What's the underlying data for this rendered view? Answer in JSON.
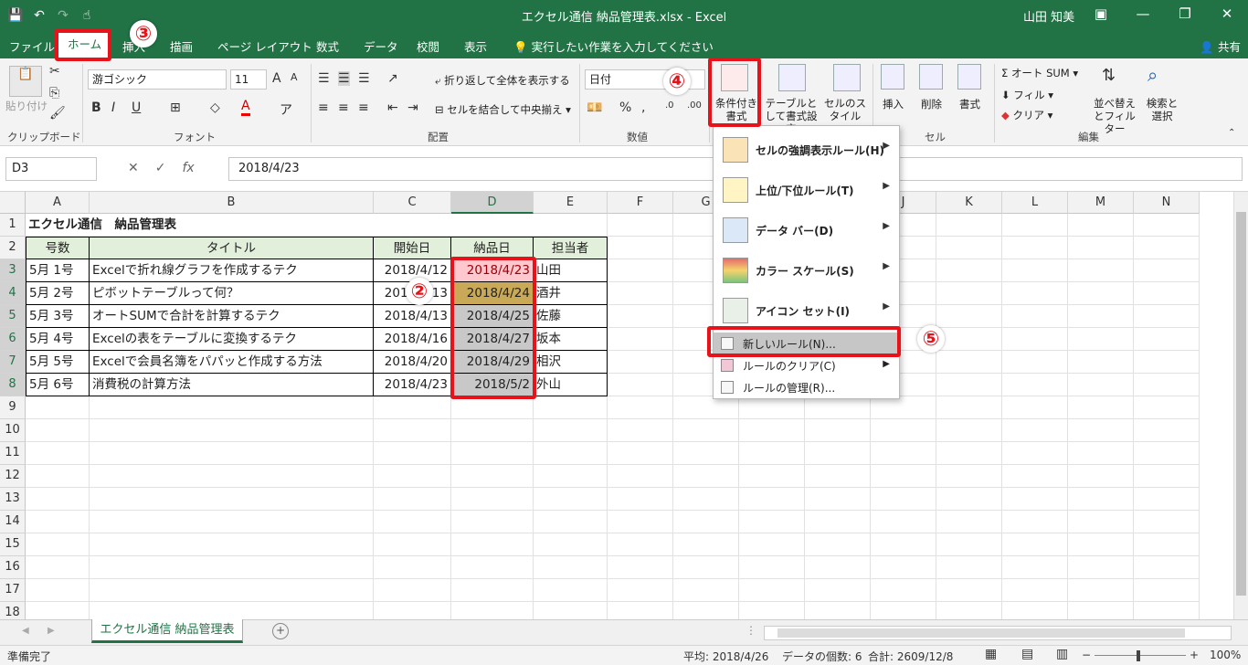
{
  "window": {
    "title": "エクセル通信 納品管理表.xlsx  -  Excel",
    "user": "山田 知美"
  },
  "tabs": [
    "ファイル",
    "ホーム",
    "挿入",
    "描画",
    "ページ レイアウト",
    "数式",
    "データ",
    "校閲",
    "表示"
  ],
  "tell_me": "実行したい作業を入力してください",
  "share": "共有",
  "ribbon": {
    "paste": "貼り付け",
    "font_name": "游ゴシック",
    "font_size": "11",
    "wrap_text": "折り返して全体を表示する",
    "merge_center": "セルを結合して中央揃え",
    "number_format": "日付",
    "conditional_format": "条件付き書式",
    "format_as_table": "テーブルとして書式設定",
    "cell_styles": "セルのスタイル",
    "insert": "挿入",
    "delete": "削除",
    "format": "書式",
    "autosum": "オート SUM",
    "fill": "フィル",
    "clear": "クリア",
    "sort_filter": "並べ替えとフィルター",
    "find_select": "検索と選択",
    "groups": [
      "クリップボード",
      "フォント",
      "配置",
      "数値",
      "セル",
      "編集"
    ]
  },
  "formula_bar": {
    "name_box": "D3",
    "formula": "2018/4/23"
  },
  "columns": [
    "A",
    "B",
    "C",
    "D",
    "E",
    "F",
    "G",
    "H",
    "I",
    "J",
    "K",
    "L",
    "M",
    "N"
  ],
  "rows": [
    "1",
    "2",
    "3",
    "4",
    "5",
    "6",
    "7",
    "8",
    "9",
    "10",
    "11",
    "12",
    "13",
    "14",
    "15",
    "16",
    "17",
    "18"
  ],
  "sheet": {
    "title": "エクセル通信　納品管理表",
    "headers": [
      "号数",
      "タイトル",
      "開始日",
      "納品日",
      "担当者"
    ],
    "data": [
      [
        "5月 1号",
        "Excelで折れ線グラフを作成するテク",
        "2018/4/12",
        "2018/4/23",
        "山田"
      ],
      [
        "5月 2号",
        "ピボットテーブルって何？",
        "2018/4/13",
        "2018/4/24",
        "酒井"
      ],
      [
        "5月 3号",
        "オートSUMで合計を計算するテク",
        "2018/4/13",
        "2018/4/25",
        "佐藤"
      ],
      [
        "5月 4号",
        "Excelの表をテーブルに変換するテク",
        "2018/4/16",
        "2018/4/27",
        "坂本"
      ],
      [
        "5月 5号",
        "Excelで会員名簿をパパッと作成する方法",
        "2018/4/20",
        "2018/4/29",
        "相沢"
      ],
      [
        "5月 6号",
        "消費税の計算方法",
        "2018/4/23",
        "2018/5/2",
        "外山"
      ]
    ]
  },
  "menu": {
    "items": [
      "セルの強調表示ルール(H)",
      "上位/下位ルール(T)",
      "データ バー(D)",
      "カラー スケール(S)",
      "アイコン セット(I)"
    ],
    "new_rule": "新しいルール(N)...",
    "clear_rules": "ルールのクリア(C)",
    "manage_rules": "ルールの管理(R)..."
  },
  "sheet_tab": "エクセル通信  納品管理表",
  "status": {
    "ready": "準備完了",
    "average": "平均: 2018/4/26",
    "count": "データの個数: 6",
    "sum": "合計: 2609/12/8",
    "zoom": "100%"
  },
  "callouts": [
    "②",
    "③",
    "④",
    "⑤"
  ],
  "colors": {
    "excel_green": "#217346",
    "highlight_red": "#e8131a",
    "header_fill": "#e2efda",
    "cell_pink": "#ffc7ce",
    "cell_gold": "#c9a957"
  }
}
